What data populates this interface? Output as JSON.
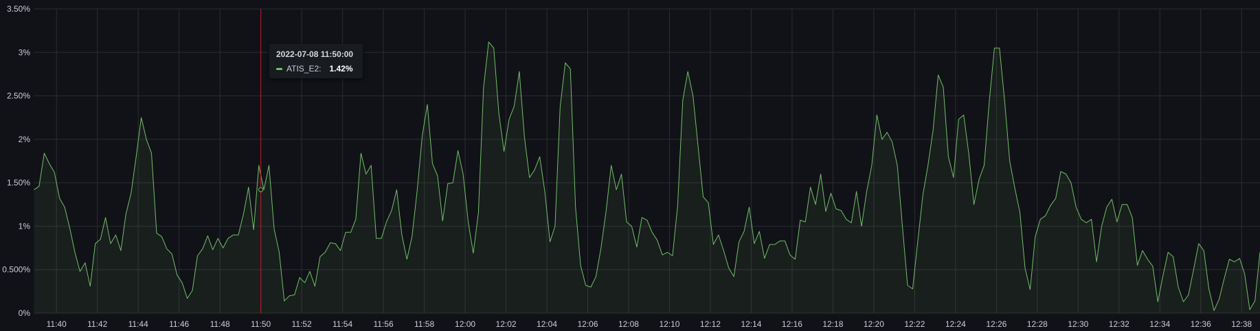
{
  "chart_data": {
    "type": "area",
    "x_axis": {
      "tick_labels": [
        "11:40",
        "11:42",
        "11:44",
        "11:46",
        "11:48",
        "11:50",
        "11:52",
        "11:54",
        "11:56",
        "11:58",
        "12:00",
        "12:02",
        "12:04",
        "12:06",
        "12:08",
        "12:10",
        "12:12",
        "12:14",
        "12:16",
        "12:18",
        "12:20",
        "12:22",
        "12:24",
        "12:26",
        "12:28",
        "12:30",
        "12:32",
        "12:34",
        "12:36",
        "12:38"
      ],
      "range": [
        "11:38:54",
        "12:38:54"
      ]
    },
    "y_axis": {
      "tick_values": [
        0,
        0.5,
        1,
        1.5,
        2,
        2.5,
        3,
        3.5
      ],
      "tick_labels": [
        "0%",
        "0.500%",
        "1%",
        "1.50%",
        "2%",
        "2.50%",
        "3%",
        "3.50%"
      ],
      "ylim": [
        0,
        3.5
      ],
      "unit": "%"
    },
    "grid": true,
    "colors": {
      "series": "#73bf69",
      "crosshair": "#c4162a",
      "background": "#111217",
      "grid": "#2c2d33"
    },
    "series": [
      {
        "name": "ATIS_E2",
        "sample_interval_seconds": 15,
        "first_timestamp": "11:38:54",
        "values": [
          1.42,
          1.46,
          1.84,
          1.72,
          1.62,
          1.32,
          1.22,
          0.98,
          0.7,
          0.48,
          0.58,
          0.31,
          0.8,
          0.85,
          1.1,
          0.8,
          0.9,
          0.72,
          1.14,
          1.38,
          1.8,
          2.25,
          2.0,
          1.84,
          0.92,
          0.88,
          0.74,
          0.68,
          0.44,
          0.35,
          0.17,
          0.26,
          0.66,
          0.74,
          0.89,
          0.73,
          0.86,
          0.75,
          0.86,
          0.9,
          0.9,
          1.14,
          1.45,
          0.96,
          1.7,
          1.42,
          1.7,
          0.97,
          0.7,
          0.14,
          0.2,
          0.21,
          0.41,
          0.35,
          0.48,
          0.31,
          0.65,
          0.7,
          0.81,
          0.8,
          0.72,
          0.93,
          0.93,
          1.08,
          1.84,
          1.6,
          1.7,
          0.86,
          0.86,
          1.05,
          1.18,
          1.42,
          0.9,
          0.62,
          0.88,
          1.41,
          2.04,
          2.4,
          1.72,
          1.58,
          1.06,
          1.49,
          1.5,
          1.87,
          1.6,
          1.05,
          0.69,
          1.16,
          2.59,
          3.12,
          3.05,
          2.3,
          1.86,
          2.23,
          2.38,
          2.78,
          2.03,
          1.56,
          1.65,
          1.8,
          1.4,
          0.82,
          1.0,
          2.37,
          2.88,
          2.81,
          1.22,
          0.55,
          0.32,
          0.3,
          0.42,
          0.75,
          1.18,
          1.7,
          1.42,
          1.6,
          1.05,
          1.0,
          0.76,
          1.1,
          1.07,
          0.93,
          0.84,
          0.67,
          0.7,
          0.66,
          1.24,
          2.45,
          2.78,
          2.5,
          1.92,
          1.34,
          1.27,
          0.79,
          0.9,
          0.72,
          0.52,
          0.42,
          0.82,
          0.94,
          1.22,
          0.8,
          0.94,
          0.63,
          0.79,
          0.79,
          0.83,
          0.83,
          0.67,
          0.62,
          1.07,
          1.05,
          1.45,
          1.25,
          1.6,
          1.17,
          1.38,
          1.2,
          1.18,
          1.08,
          1.04,
          1.4,
          1.0,
          1.4,
          1.7,
          2.28,
          2.0,
          2.08,
          1.97,
          1.7,
          1.0,
          0.32,
          0.28,
          0.82,
          1.36,
          1.7,
          2.1,
          2.74,
          2.6,
          1.8,
          1.56,
          2.23,
          2.28,
          1.83,
          1.25,
          1.54,
          1.7,
          2.43,
          3.05,
          3.05,
          2.45,
          1.75,
          1.44,
          1.16,
          0.52,
          0.27,
          0.88,
          1.08,
          1.12,
          1.24,
          1.32,
          1.63,
          1.6,
          1.5,
          1.22,
          1.08,
          1.04,
          1.08,
          0.59,
          1.0,
          1.22,
          1.31,
          1.05,
          1.25,
          1.25,
          1.1,
          0.55,
          0.72,
          0.62,
          0.54,
          0.13,
          0.43,
          0.7,
          0.65,
          0.3,
          0.13,
          0.21,
          0.5,
          0.8,
          0.72,
          0.28,
          0.03,
          0.16,
          0.4,
          0.62,
          0.59,
          0.63,
          0.45,
          0.04,
          0.14,
          0.7
        ]
      }
    ],
    "crosshair": {
      "x": "11:50:00"
    },
    "tooltip": {
      "time": "2022-07-08 11:50:00",
      "series_label": "ATIS_E2:",
      "value_label": "1.42%",
      "value": 1.42
    }
  }
}
